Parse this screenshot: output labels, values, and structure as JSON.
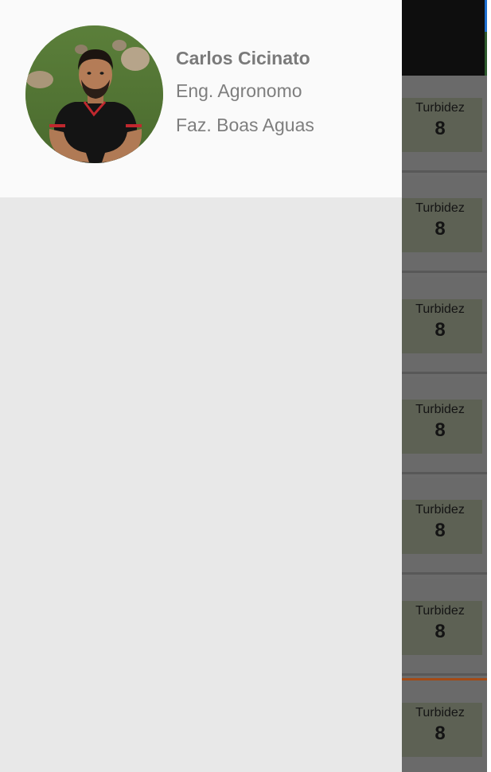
{
  "drawer": {
    "user": {
      "name": "Carlos Cicinato",
      "role": "Eng. Agronomo",
      "farm": "Faz. Boas Aguas"
    },
    "avatar_icon": "user-photo-icon"
  },
  "background_list": {
    "cards": [
      {
        "metric_label": "Turbidez",
        "metric_value": "8"
      },
      {
        "metric_label": "Turbidez",
        "metric_value": "8"
      },
      {
        "metric_label": "Turbidez",
        "metric_value": "8"
      },
      {
        "metric_label": "Turbidez",
        "metric_value": "8"
      },
      {
        "metric_label": "Turbidez",
        "metric_value": "8"
      },
      {
        "metric_label": "Turbidez",
        "metric_value": "8"
      },
      {
        "metric_label": "Turbidez",
        "metric_value": "8"
      }
    ]
  },
  "colors": {
    "drawer_header_bg": "#fafafa",
    "drawer_body_bg": "#e8e8e8",
    "scrim": "#6b6b6b",
    "metric_box": "#5d6154",
    "accent_orange": "#a34a16"
  }
}
